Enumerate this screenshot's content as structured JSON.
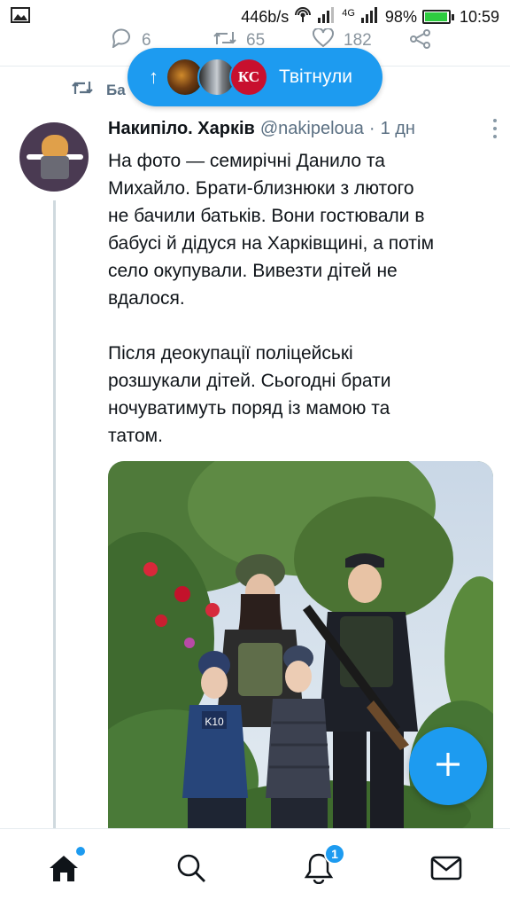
{
  "status_bar": {
    "speed": "446b/s",
    "network": "4G",
    "battery": "98%",
    "battery_level": 0.98,
    "time": "10:59"
  },
  "prev_tweet_actions": {
    "replies": "6",
    "retweets": "65",
    "likes": "182"
  },
  "retweet_header": {
    "label": "Ба"
  },
  "new_tweets_pill": {
    "label": "Твітнули",
    "avatar_text": "КС"
  },
  "tweet": {
    "author_name": "Накипіло. Харків",
    "author_handle": "@nakipeloua",
    "separator": "·",
    "time": "1 дн",
    "text_lines_p1": [
      "На фото — семирічні Данило та",
      "Михайло. Брати-близнюки з лютого",
      "не бачили батьків. Вони гостювали в",
      "бабусі й дідуся на Харківщині, а потім",
      "село окупували. Вивезти дітей не",
      "вдалося."
    ],
    "text_lines_p2": [
      "Після деокупації поліцейські",
      "розшукали дітей. Сьогодні брати",
      "ночуватимуть поряд із мамою та",
      "татом."
    ],
    "photo_jacket_text": "K10"
  },
  "bottom_nav": {
    "notifications_badge": "1"
  },
  "colors": {
    "accent": "#1d9bf0",
    "secondary_text": "#5b7083",
    "divider": "#e6ecf0"
  },
  "icons": {
    "status": [
      "image-icon",
      "wifi-icon",
      "signal-icon",
      "battery-icon"
    ],
    "actions": [
      "reply-icon",
      "retweet-icon",
      "like-icon",
      "share-icon"
    ],
    "nav": [
      "home-icon",
      "search-icon",
      "notifications-icon",
      "messages-icon"
    ],
    "fab": "compose-plus-icon"
  }
}
